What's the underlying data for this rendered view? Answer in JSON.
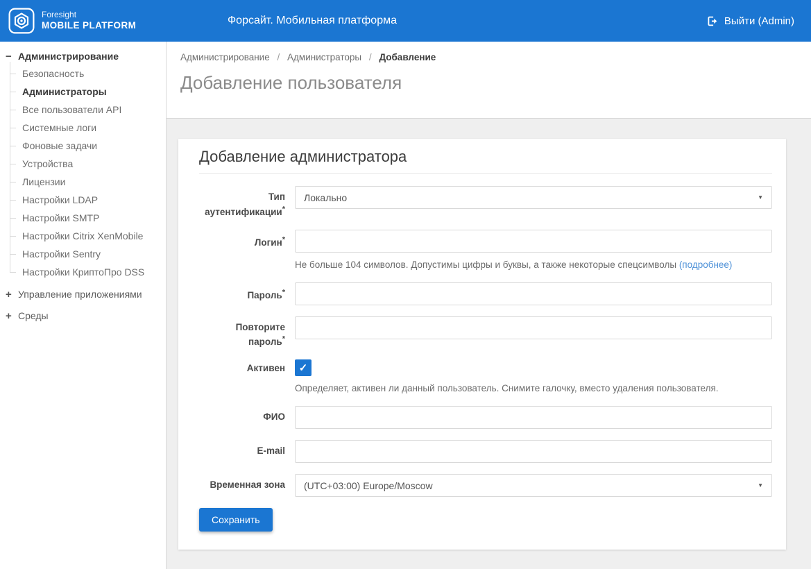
{
  "colors": {
    "header_background": "#1b76d2",
    "accent_blue": "#1b76d2",
    "link_blue": "#4f92d8",
    "content_background": "#efefef"
  },
  "icons": {
    "collapse": "−",
    "expand": "+",
    "dropdown_caret": "▼",
    "checkmark": "✓"
  },
  "header": {
    "brand_line1": "Foresight",
    "brand_line2": "MOBILE PLATFORM",
    "app_title": "Форсайт. Мобильная платформа",
    "logout": {
      "label": "Выйти (Admin)"
    }
  },
  "sidebar": {
    "admin_section": {
      "label": "Администрирование",
      "expanded": true
    },
    "admin_children": [
      {
        "label": "Безопасность"
      },
      {
        "label": "Администраторы",
        "active": true
      },
      {
        "label": "Все пользователи API"
      },
      {
        "label": "Системные логи"
      },
      {
        "label": "Фоновые задачи"
      },
      {
        "label": "Устройства"
      },
      {
        "label": "Лицензии"
      },
      {
        "label": "Настройки LDAP"
      },
      {
        "label": "Настройки SMTP"
      },
      {
        "label": "Настройки Citrix XenMobile"
      },
      {
        "label": "Настройки Sentry"
      },
      {
        "label": "Настройки КриптоПро DSS"
      }
    ],
    "collapsed_sections": [
      {
        "label": "Управление приложениями"
      },
      {
        "label": "Среды"
      }
    ]
  },
  "breadcrumb": {
    "separator": "/",
    "items": [
      {
        "label": "Администрирование"
      },
      {
        "label": "Администраторы"
      },
      {
        "label": "Добавление",
        "current": true
      }
    ]
  },
  "page": {
    "title": "Добавление пользователя"
  },
  "form": {
    "heading": "Добавление администратора",
    "required_marker": "*",
    "fields": {
      "auth_type": {
        "label": "Тип аутентификации",
        "required": true,
        "type": "select",
        "value": "Локально"
      },
      "login": {
        "label": "Логин",
        "required": true,
        "type": "text",
        "value": "",
        "help_text": "Не больше 104 символов. Допустимы цифры и буквы, а также некоторые спецсимволы",
        "help_link": "(подробнее)"
      },
      "password": {
        "label": "Пароль",
        "required": true,
        "type": "password",
        "value": ""
      },
      "password_repeat": {
        "label": "Повторите пароль",
        "required": true,
        "type": "password",
        "value": ""
      },
      "active": {
        "label": "Активен",
        "type": "checkbox",
        "checked": true,
        "help_text": "Определяет, активен ли данный пользователь. Снимите галочку, вместо удаления пользователя."
      },
      "full_name": {
        "label": "ФИО",
        "type": "text",
        "value": ""
      },
      "email": {
        "label": "E-mail",
        "type": "text",
        "value": ""
      },
      "timezone": {
        "label": "Временная зона",
        "type": "select",
        "value": "(UTC+03:00) Europe/Moscow"
      }
    },
    "submit_label": "Сохранить"
  }
}
